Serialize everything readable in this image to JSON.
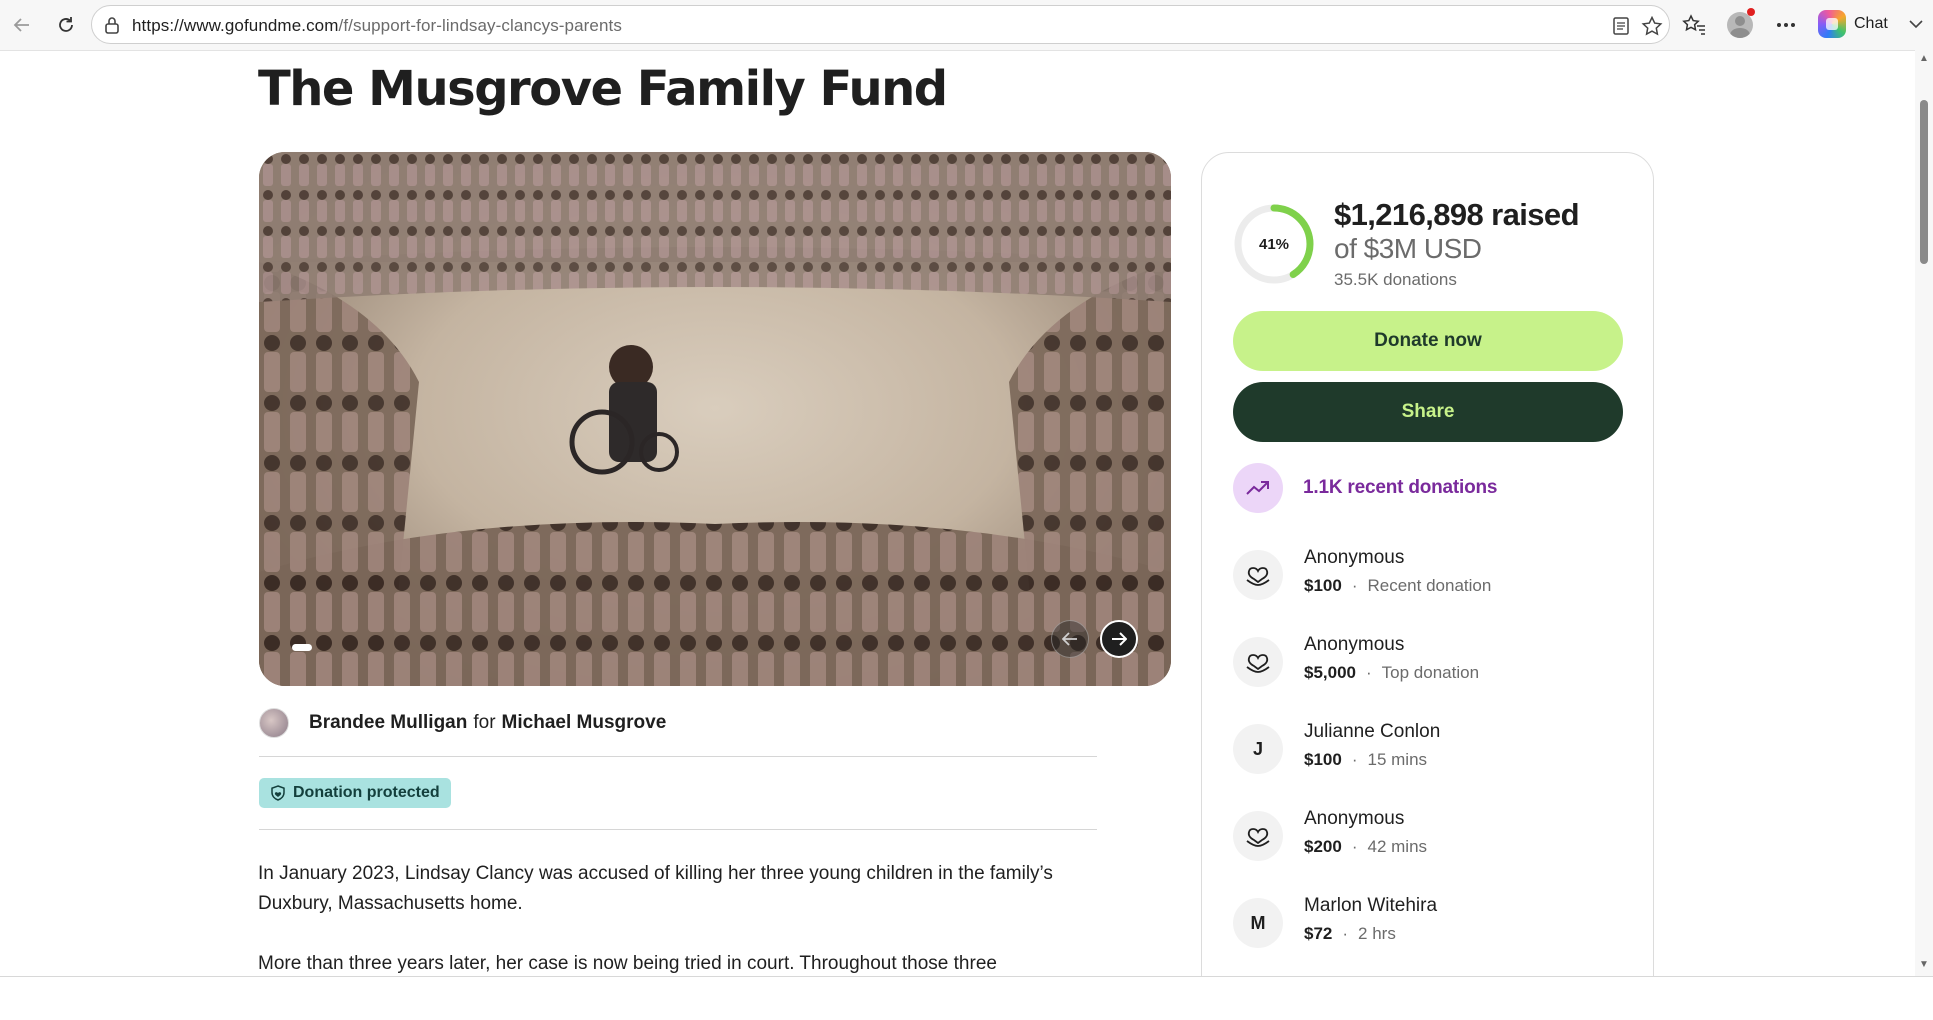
{
  "browser": {
    "url_host": "https://www.gofundme.com",
    "url_path": "/f/support-for-lindsay-clancys-parents",
    "chat_label": "Chat"
  },
  "page": {
    "title": "The Musgrove Family Fund",
    "organizer": {
      "name": "Brandee Mulligan",
      "for_label": "for",
      "beneficiary": "Michael Musgrove"
    },
    "protected_badge": "Donation protected",
    "story": [
      "In January 2023, Lindsay Clancy was accused of killing her three young children in the family’s Duxbury, Massachusetts home.",
      "More than three years later, her case is now being tried in court. Throughout those three"
    ]
  },
  "card": {
    "percent": 41,
    "percent_label": "41%",
    "raised": "$1,216,898 raised",
    "goal": "of $3M USD",
    "donations_count": "35.5K donations",
    "donate_label": "Donate now",
    "share_label": "Share",
    "recent_label": "1.1K recent donations",
    "donors": [
      {
        "name": "Anonymous",
        "amount": "$100",
        "note": "Recent donation",
        "initial": ""
      },
      {
        "name": "Anonymous",
        "amount": "$5,000",
        "note": "Top donation",
        "initial": ""
      },
      {
        "name": "Julianne Conlon",
        "amount": "$100",
        "note": "15 mins",
        "initial": "J"
      },
      {
        "name": "Anonymous",
        "amount": "$200",
        "note": "42 mins",
        "initial": ""
      },
      {
        "name": "Marlon Witehira",
        "amount": "$72",
        "note": "2 hrs",
        "initial": "M"
      }
    ],
    "colors": {
      "progress": "#7fd14b",
      "donate_bg": "#c7f28a",
      "share_bg": "#1f3a2b",
      "recent_text": "#7a2a9c"
    }
  },
  "icons": {
    "back": "back-arrow-icon",
    "reload": "reload-icon",
    "lock": "lock-icon",
    "reading": "reading-view-icon",
    "favorite": "star-icon",
    "favorites": "favorites-icon",
    "profile": "profile-icon",
    "more": "more-icon",
    "copilot": "copilot-icon",
    "trend": "trending-up-icon",
    "heart_hand": "donation-heart-icon",
    "shield": "shield-icon"
  }
}
